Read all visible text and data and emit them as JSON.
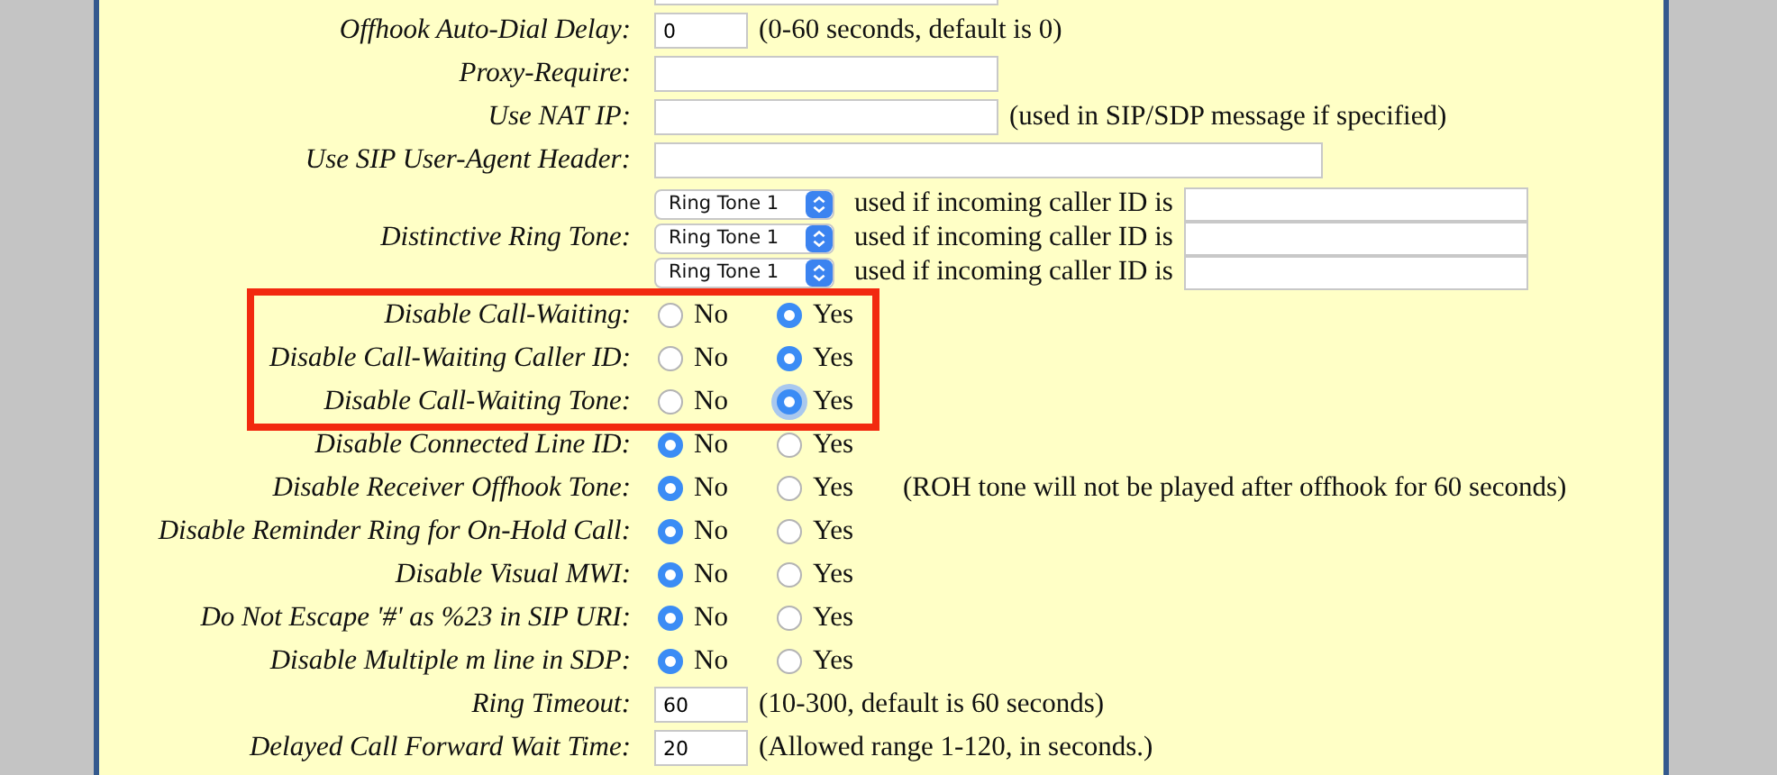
{
  "rows": [
    {
      "kind": "cut"
    },
    {
      "kind": "number",
      "label": "Offhook Auto-Dial Delay:",
      "value": "0",
      "note": "(0-60 seconds, default is 0)"
    },
    {
      "kind": "text",
      "label": "Proxy-Require:"
    },
    {
      "kind": "text",
      "label": "Use NAT IP:",
      "note": "(used in SIP/SDP message if specified)"
    },
    {
      "kind": "long_text",
      "label": "Use SIP User-Agent Header:"
    },
    {
      "kind": "ringtones",
      "label": "Distinctive Ring Tone:",
      "entries": [
        {
          "value": "Ring Tone 1",
          "text": "used if incoming caller ID is"
        },
        {
          "value": "Ring Tone 1",
          "text": "used if incoming caller ID is"
        },
        {
          "value": "Ring Tone 1",
          "text": "used if incoming caller ID is"
        }
      ]
    },
    {
      "kind": "radio",
      "label": "Disable Call-Waiting:",
      "highlighted": true,
      "options": [
        {
          "label": "No",
          "selected": false,
          "focused": false
        },
        {
          "label": "Yes",
          "selected": true,
          "focused": false
        }
      ]
    },
    {
      "kind": "radio",
      "label": "Disable Call-Waiting Caller ID:",
      "highlighted": true,
      "options": [
        {
          "label": "No",
          "selected": false,
          "focused": false
        },
        {
          "label": "Yes",
          "selected": true,
          "focused": false
        }
      ]
    },
    {
      "kind": "radio",
      "label": "Disable Call-Waiting Tone:",
      "highlighted": true,
      "options": [
        {
          "label": "No",
          "selected": false,
          "focused": false
        },
        {
          "label": "Yes",
          "selected": true,
          "focused": true
        }
      ]
    },
    {
      "kind": "radio",
      "label": "Disable Connected Line ID:",
      "highlighted": false,
      "options": [
        {
          "label": "No",
          "selected": true,
          "focused": false
        },
        {
          "label": "Yes",
          "selected": false,
          "focused": false
        }
      ]
    },
    {
      "kind": "radio",
      "label": "Disable Receiver Offhook Tone:",
      "highlighted": false,
      "note": "(ROH tone will not be played after offhook for 60 seconds)",
      "options": [
        {
          "label": "No",
          "selected": true,
          "focused": false
        },
        {
          "label": "Yes",
          "selected": false,
          "focused": false
        }
      ]
    },
    {
      "kind": "radio",
      "label": "Disable Reminder Ring for On-Hold Call:",
      "highlighted": false,
      "options": [
        {
          "label": "No",
          "selected": true,
          "focused": false
        },
        {
          "label": "Yes",
          "selected": false,
          "focused": false
        }
      ]
    },
    {
      "kind": "radio",
      "label": "Disable Visual MWI:",
      "highlighted": false,
      "options": [
        {
          "label": "No",
          "selected": true,
          "focused": false
        },
        {
          "label": "Yes",
          "selected": false,
          "focused": false
        }
      ]
    },
    {
      "kind": "radio",
      "label": "Do Not Escape '#' as %23 in SIP URI:",
      "highlighted": false,
      "options": [
        {
          "label": "No",
          "selected": true,
          "focused": false
        },
        {
          "label": "Yes",
          "selected": false,
          "focused": false
        }
      ]
    },
    {
      "kind": "radio",
      "label": "Disable Multiple m line in SDP:",
      "highlighted": false,
      "options": [
        {
          "label": "No",
          "selected": true,
          "focused": false
        },
        {
          "label": "Yes",
          "selected": false,
          "focused": false
        }
      ]
    },
    {
      "kind": "number",
      "label": "Ring Timeout:",
      "value": "60",
      "note": "(10-300, default is 60 seconds)"
    },
    {
      "kind": "number",
      "label": "Delayed Call Forward Wait Time:",
      "value": "20",
      "note": "(Allowed range 1-120, in seconds.)"
    }
  ]
}
